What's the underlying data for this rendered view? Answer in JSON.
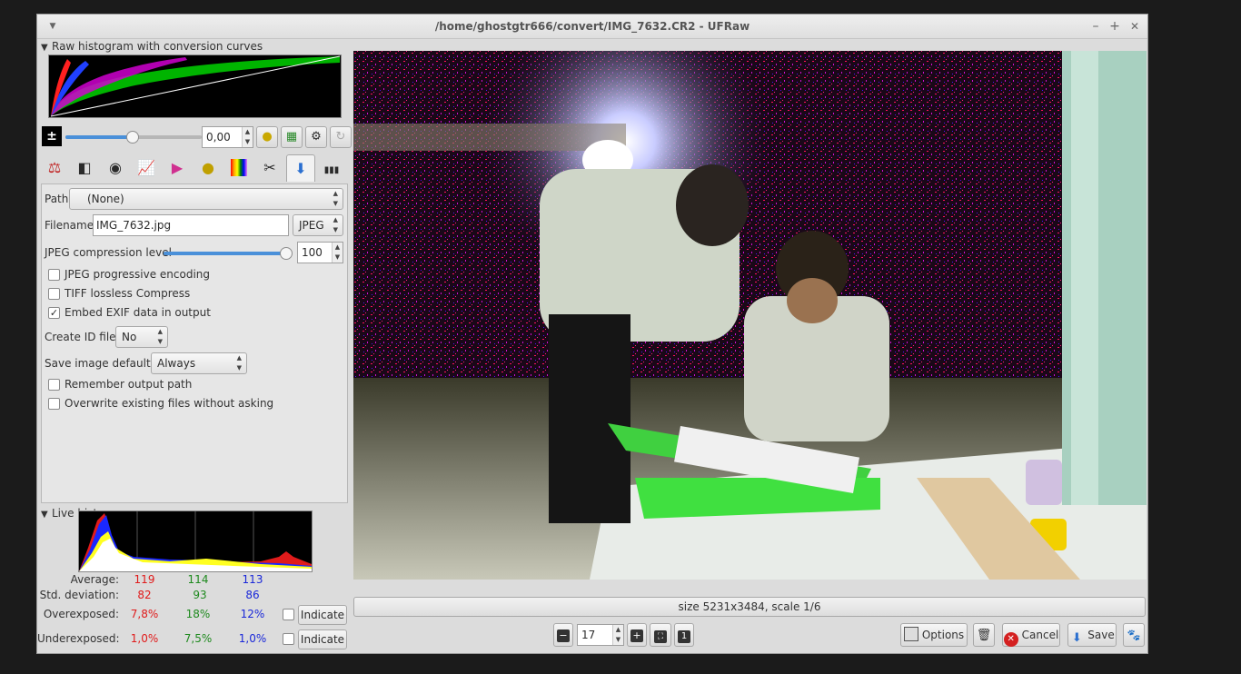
{
  "window": {
    "title": "/home/ghostgtr666/convert/IMG_7632.CR2 - UFRaw",
    "minimize": "–",
    "maximize": "+",
    "close": "✕"
  },
  "raw_histogram": {
    "label": "Raw histogram with conversion curves"
  },
  "exposure": {
    "value": "0,00"
  },
  "save": {
    "path_label": "Path",
    "path_value": "(None)",
    "filename_label": "Filename",
    "filename_value": "IMG_7632.jpg",
    "format_value": "JPEG",
    "jpeg_level_label": "JPEG compression level",
    "jpeg_level_value": "100",
    "jpeg_level": 1.0,
    "progressive_label": "JPEG progressive encoding",
    "progressive_checked": false,
    "tiff_label": "TIFF lossless Compress",
    "tiff_checked": false,
    "exif_label": "Embed EXIF data in output",
    "exif_checked": true,
    "create_id_label": "Create ID file",
    "create_id_value": "No",
    "save_defaults_label": "Save image defaults",
    "save_defaults_value": "Always",
    "remember_label": "Remember output path",
    "remember_checked": false,
    "overwrite_label": "Overwrite existing files without asking",
    "overwrite_checked": false
  },
  "live_histogram": {
    "label": "Live histogram",
    "average_label": "Average:",
    "average": [
      "119",
      "114",
      "113"
    ],
    "stddev_label": "Std. deviation:",
    "stddev": [
      "82",
      "93",
      "86"
    ],
    "over_label": "Overexposed:",
    "over": [
      "7,8%",
      "18%",
      "12%"
    ],
    "under_label": "Underexposed:",
    "under": [
      "1,0%",
      "7,5%",
      "1,0%"
    ],
    "indicate": "Indicate"
  },
  "status": {
    "text": "size 5231x3484, scale 1/6"
  },
  "zoom": {
    "value": "17"
  },
  "buttons": {
    "options": "Options",
    "cancel": "Cancel",
    "save": "Save"
  },
  "colors": {
    "accent": "#4a90d9",
    "red": "#e01b1b",
    "green": "#1f8a1f",
    "blue": "#1a28d9"
  }
}
